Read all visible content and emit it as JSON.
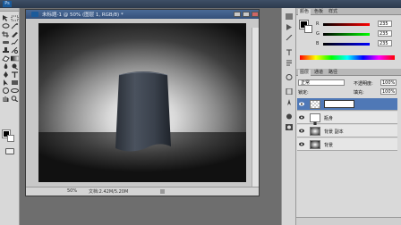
{
  "doc": {
    "title": "未标题-1 @ 50% (图层 1, RGB/8) *",
    "zoom": "50%",
    "info": "文档:2.42M/5.20M"
  },
  "panels": {
    "color_tab": "颜色",
    "swatches_tab": "色板",
    "styles_tab": "样式",
    "color": {
      "labels": [
        "R",
        "G",
        "B"
      ],
      "values": [
        "235",
        "235",
        "235"
      ]
    },
    "layers_tab": "图层",
    "channels_tab": "通道",
    "paths_tab": "路径",
    "blend_mode": "正常",
    "opacity_label": "不透明度:",
    "opacity": "100%",
    "lock_label": "锁定:",
    "fill_label": "填充:",
    "fill": "100%",
    "layers": [
      {
        "name": "",
        "selected": true
      },
      {
        "name": "瓶身",
        "selected": false
      },
      {
        "name": "背景 副本",
        "selected": false
      },
      {
        "name": "背景",
        "selected": false
      }
    ]
  },
  "colors": {
    "title_bar": "#3d5a84",
    "selected_layer": "#4f78b6",
    "panel_bg": "#d9d9d9"
  }
}
